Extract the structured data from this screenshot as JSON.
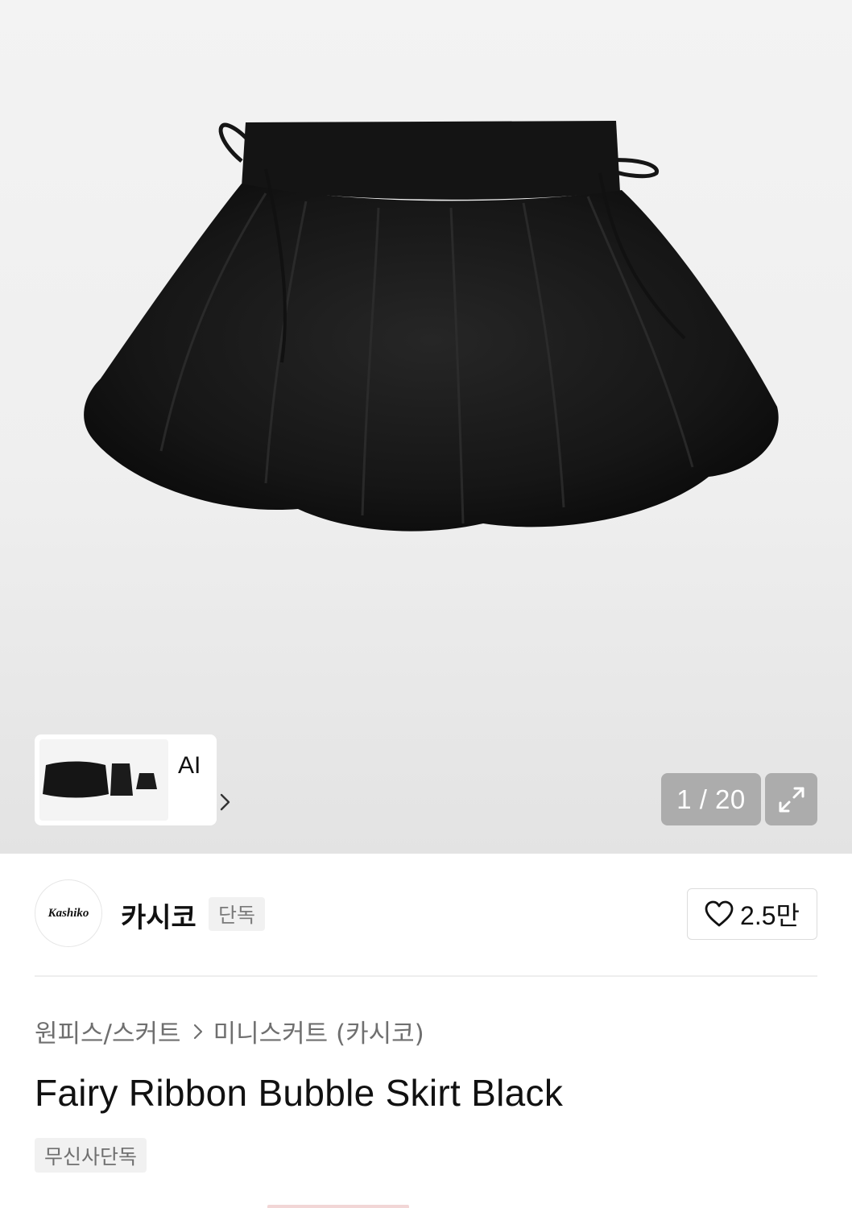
{
  "gallery": {
    "ai_label": "AI",
    "counter": "1 / 20"
  },
  "brand": {
    "logo_text": "Kashiko",
    "name": "카시코",
    "exclusive_tag": "단독",
    "likes": "2.5만"
  },
  "breadcrumb": {
    "category": "원피스/스커트",
    "subcategory": "미니스커트 (카시코)"
  },
  "product": {
    "title": "Fairy Ribbon Bubble Skirt Black",
    "badge": "무신사단독"
  },
  "icons": {
    "expand": "expand-arrows-icon",
    "like": "heart-outline-icon",
    "ai_next": "chevron-right-icon",
    "breadcrumb_sep": "chevron-right-icon"
  },
  "colors": {
    "text_primary": "#111111",
    "text_secondary": "#6f6f6f",
    "tag_bg": "#f1f1f1",
    "overlay_gray": "#969696"
  }
}
